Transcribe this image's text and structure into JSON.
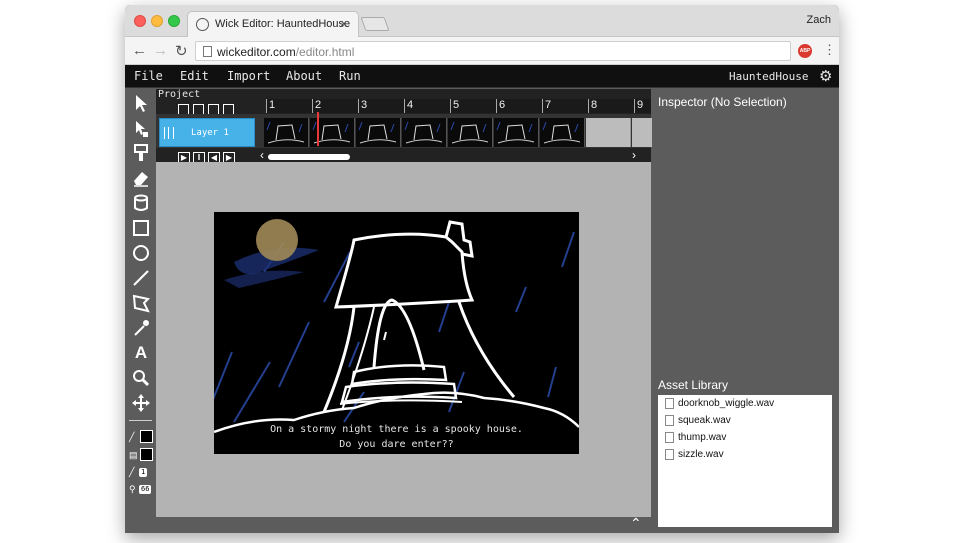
{
  "browser": {
    "tab_title": "Wick Editor: HauntedHouse",
    "tab_close": "×",
    "profile": "Zach",
    "url_host": "wickeditor.com",
    "url_path": "/editor.html",
    "extension_badge": "ABP"
  },
  "menu": {
    "items": [
      "File",
      "Edit",
      "Import",
      "About",
      "Run"
    ],
    "project_name": "HauntedHouse"
  },
  "toolbar": {
    "tools": [
      "cursor-icon",
      "pen-select-icon",
      "paintbrush-icon",
      "eraser-icon",
      "fill-bucket-icon",
      "rectangle-icon",
      "ellipse-icon",
      "line-icon",
      "polygon-icon",
      "eyedropper-icon",
      "text-icon",
      "zoom-icon",
      "pan-icon"
    ],
    "stroke_width": "1",
    "zoom_level": "66",
    "fill_color": "#000000",
    "stroke_color": "#000000"
  },
  "timeline": {
    "label": "Project",
    "layer_name": "Layer 1",
    "frame_numbers": [
      "1",
      "2",
      "3",
      "4",
      "5",
      "6",
      "7",
      "8",
      "9"
    ],
    "filled_frames": 7
  },
  "stage": {
    "caption_line1": "On a stormy night there is a spooky house.",
    "caption_line2": "Do you dare enter??"
  },
  "inspector": {
    "title": "Inspector (No Selection)",
    "asset_library_title": "Asset Library",
    "assets": [
      "doorknob_wiggle.wav",
      "squeak.wav",
      "thump.wav",
      "sizzle.wav"
    ]
  },
  "colors": {
    "layer_accent": "#46b2e8",
    "playhead": "#e83838",
    "panel_bg": "#5c5c5c",
    "stage_bg": "#b3b3b3"
  }
}
